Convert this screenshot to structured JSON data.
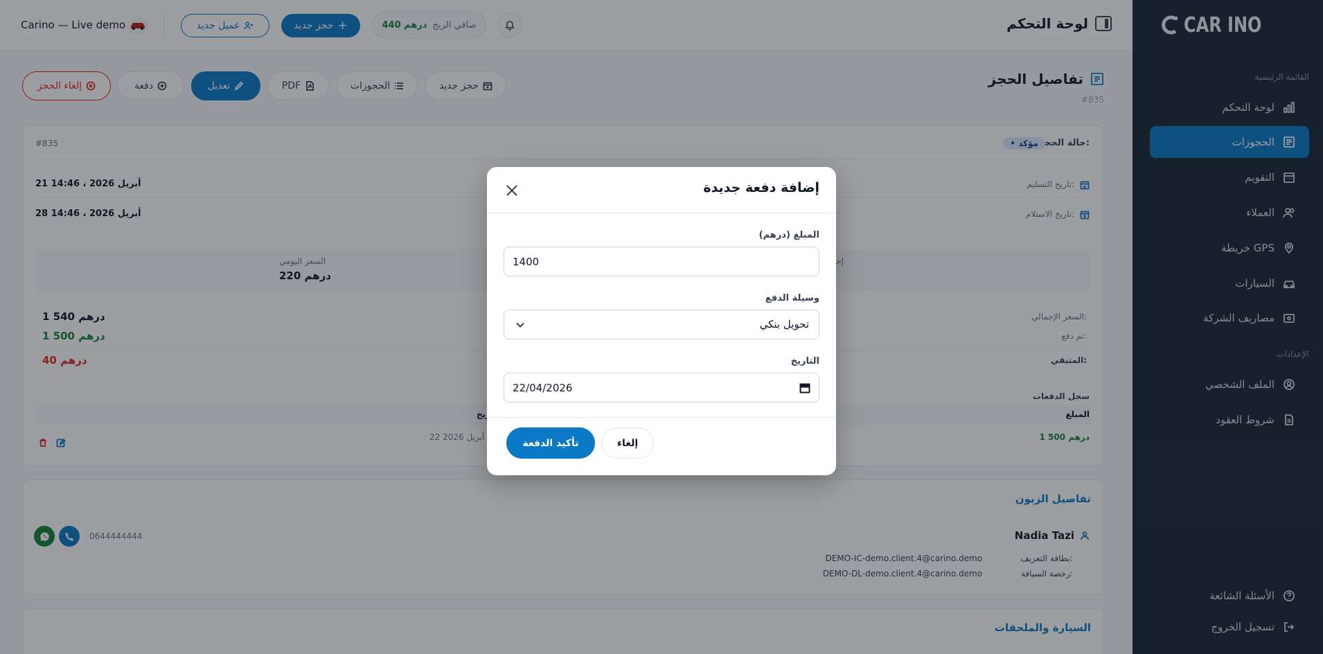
{
  "sidebar": {
    "logo_text": "CAR INO",
    "section_main": "القائمة الرئيسية",
    "section_settings": "الإعدادات",
    "items": [
      {
        "label": "لوحة التحكم",
        "icon": "chart-icon"
      },
      {
        "label": "الحجوزات",
        "icon": "booking-icon",
        "active": true
      },
      {
        "label": "التقويم",
        "icon": "calendar-icon"
      },
      {
        "label": "العملاء",
        "icon": "users-icon"
      },
      {
        "label": "خريطة GPS",
        "icon": "map-pin-icon"
      },
      {
        "label": "السيارات",
        "icon": "car-icon"
      },
      {
        "label": "مصاريف الشركة",
        "icon": "wallet-icon"
      }
    ],
    "settings_items": [
      {
        "label": "الملف الشخصي",
        "icon": "user-circle-icon"
      },
      {
        "label": "شروط العقود",
        "icon": "document-icon"
      }
    ],
    "bottom_items": [
      {
        "label": "الأسئلة الشائعة",
        "icon": "help-icon"
      },
      {
        "label": "تسجيل الخروج",
        "icon": "logout-icon"
      }
    ]
  },
  "topbar": {
    "title": "لوحة التحكم",
    "profit_label": "صافي الربح",
    "profit_value": "440 درهم",
    "new_booking": "حجز جديد",
    "new_client": "عميل جديد",
    "brand_name": "Carino — Live demo"
  },
  "page": {
    "title": "تفاصيل الحجز",
    "subtitle": "#835",
    "actions": {
      "new_booking": "حجز جديد",
      "bookings": "الحجوزات",
      "pdf": "PDF",
      "edit": "تعديل",
      "payment": "دفعة",
      "cancel_booking": "إلغاء الحجز"
    }
  },
  "booking": {
    "status_label": "حالة الحجز:",
    "status_value": "• مؤكد",
    "id": "#835",
    "delivery_label": "تاريخ التسليم:",
    "delivery_value": "21 أبريل 2026 ، 14:46",
    "return_label": "تاريخ الاستلام:",
    "return_value": "28 أبريل 2026 ، 14:46",
    "total_days_partial": "إجـ",
    "daily_price_label": "السعر اليومي",
    "daily_price_value": "220 درهم",
    "total_label": "السعر الإجمالي:",
    "total_value": "1 540 درهم",
    "paid_label": "تم دفع:",
    "paid_value": "1 500 درهم",
    "remaining_label": "المتبقي:",
    "remaining_value": "40 درهم",
    "payments_log": "سجل الدفعات",
    "col_amount": "المبلغ",
    "col_date": "التاريخ",
    "payment_row_amount": "1 500 درهم",
    "payment_row_date": "22 أبريل 2026"
  },
  "customer": {
    "section_title": "تفاصيل الزبون",
    "name": "Nadia Tazi",
    "phone": "0644444444",
    "id_label": "بطاقة التعريف:",
    "id_value": "DEMO-IC-demo.client.4@carino.demo",
    "license_label": "رخصة السياقة:",
    "license_value": "DEMO-DL-demo.client.4@carino.demo"
  },
  "car_section_title": "السيارة والملحقات",
  "modal": {
    "title": "إضافة دفعة جديدة",
    "amount_label": "المبلغ (درهم)",
    "amount_value": "1400",
    "method_label": "وسيلة الدفع",
    "method_value": "تحويل بنكي",
    "date_label": "التاريخ",
    "date_value": "22/04/2026",
    "confirm": "تأكيد الدفعة",
    "cancel": "إلغاء"
  },
  "colors": {
    "primary": "#0b79c6",
    "sidebar_bg": "#1b2838",
    "success": "#15803d",
    "danger": "#dc2626"
  }
}
